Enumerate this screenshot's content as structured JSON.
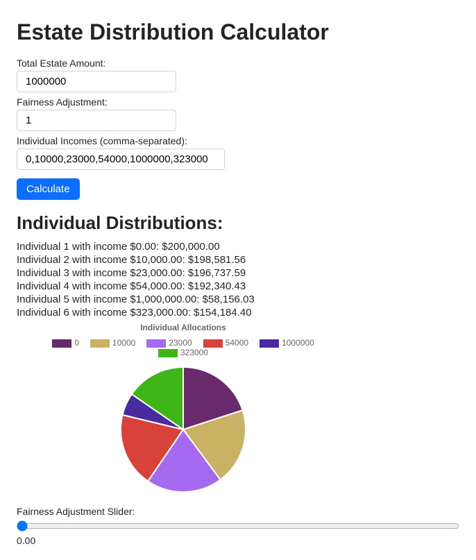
{
  "title": "Estate Distribution Calculator",
  "form": {
    "total_label": "Total Estate Amount:",
    "total_value": "1000000",
    "fairness_label": "Fairness Adjustment:",
    "fairness_value": "1",
    "incomes_label": "Individual Incomes (comma-separated):",
    "incomes_value": "0,10000,23000,54000,1000000,323000",
    "calculate_label": "Calculate"
  },
  "distributions": {
    "heading": "Individual Distributions:",
    "rows": [
      "Individual 1 with income $0.00: $200,000.00",
      "Individual 2 with income $10,000.00: $198,581.56",
      "Individual 3 with income $23,000.00: $196,737.59",
      "Individual 4 with income $54,000.00: $192,340.43",
      "Individual 5 with income $1,000,000.00: $58,156.03",
      "Individual 6 with income $323,000.00: $154,184.40"
    ]
  },
  "chart_data": {
    "type": "pie",
    "title": "Individual Allocations",
    "series": [
      {
        "name": "0",
        "value": 200000.0,
        "color": "#692a6c"
      },
      {
        "name": "10000",
        "value": 198581.56,
        "color": "#c9b263"
      },
      {
        "name": "23000",
        "value": 196737.59,
        "color": "#a56af0"
      },
      {
        "name": "54000",
        "value": 192340.43,
        "color": "#d9423a"
      },
      {
        "name": "1000000",
        "value": 58156.03,
        "color": "#4a2a9f"
      },
      {
        "name": "323000",
        "value": 154184.4,
        "color": "#3fb618"
      }
    ]
  },
  "slider": {
    "label": "Fairness Adjustment Slider:",
    "value": "0.00"
  }
}
